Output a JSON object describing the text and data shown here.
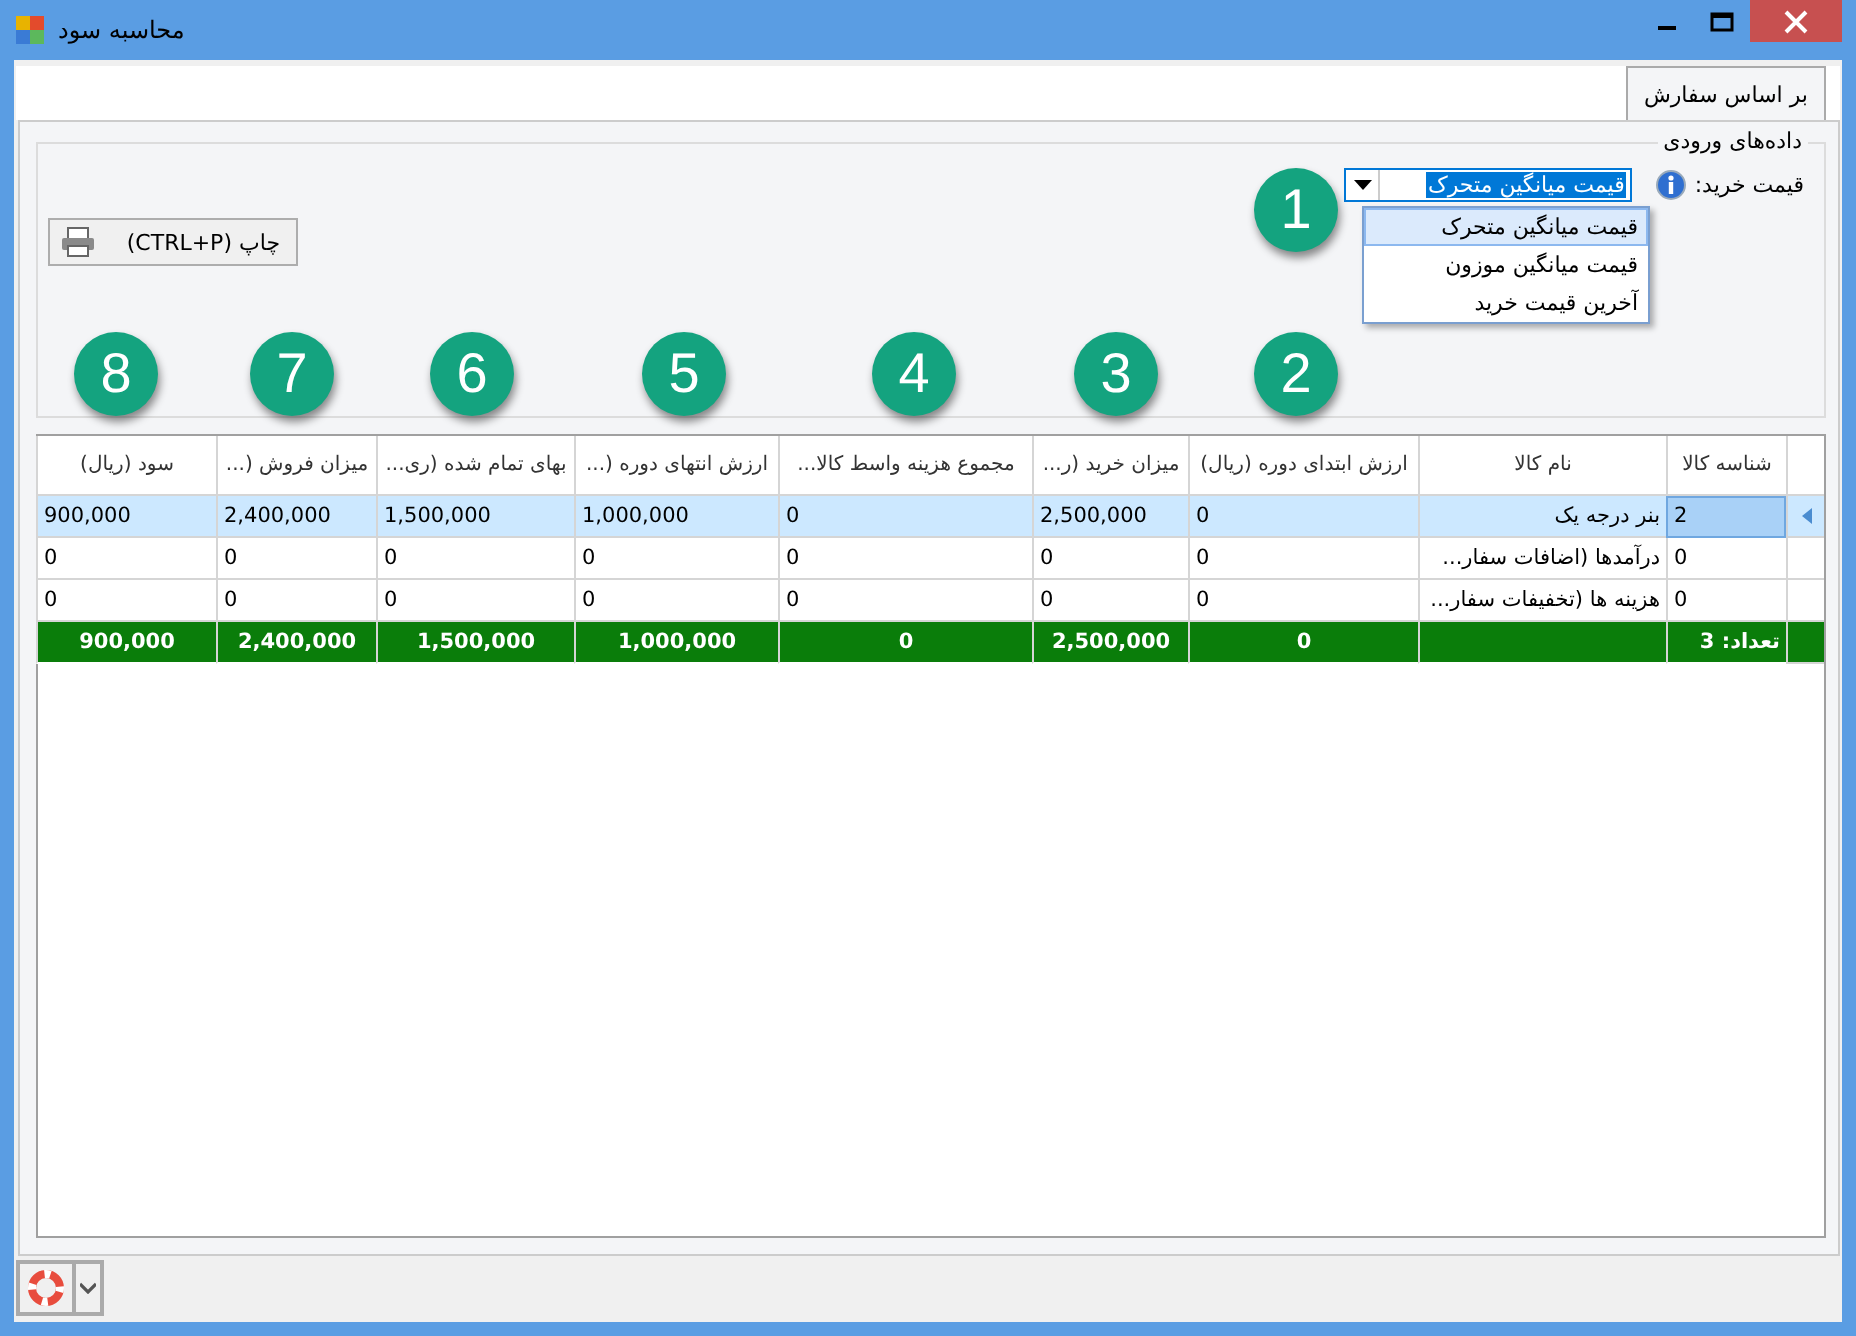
{
  "window": {
    "title": "محاسبه سود"
  },
  "tabs": [
    {
      "label": "بر اساس سفارش",
      "selected": true
    }
  ],
  "input_group": {
    "title": "داده‌های ورودی",
    "purchase_price": {
      "label": "قیمت خرید:",
      "value": "قیمت میانگین متحرک",
      "expanded": true,
      "options": [
        {
          "label": "قیمت میانگین متحرک",
          "selected": true
        },
        {
          "label": "قیمت میانگین موزون",
          "selected": false
        },
        {
          "label": "آخرین قیمت خرید",
          "selected": false
        }
      ]
    }
  },
  "print_button": {
    "label": "چاپ (CTRL+P)"
  },
  "annotations": [
    "1",
    "2",
    "3",
    "4",
    "5",
    "6",
    "7",
    "8"
  ],
  "table": {
    "columns": [
      "شناسه کالا",
      "نام کالا",
      "ارزش ابتدای دوره (ریال)",
      "میزان خرید (ر...",
      "مجموع هزینه واسط کالا...",
      "ارزش انتهای دوره (...",
      "بهای تمام شده (ری...",
      "میزان فروش (...",
      "سود (ریال)"
    ],
    "rows": [
      {
        "selected": true,
        "cells": [
          "2",
          "بنر درجه یک",
          "0",
          "2,500,000",
          "0",
          "1,000,000",
          "1,500,000",
          "2,400,000",
          "900,000"
        ]
      },
      {
        "selected": false,
        "cells": [
          "0",
          "درآمدها (اضافات سفار...",
          "0",
          "0",
          "0",
          "0",
          "0",
          "0",
          "0"
        ]
      },
      {
        "selected": false,
        "cells": [
          "0",
          "هزینه ها (تخفیفات سفار...",
          "0",
          "0",
          "0",
          "0",
          "0",
          "0",
          "0"
        ]
      }
    ],
    "totals": {
      "count": "تعداد: 3",
      "values": [
        "0",
        "2,500,000",
        "0",
        "1,000,000",
        "1,500,000",
        "2,400,000",
        "900,000"
      ]
    }
  }
}
